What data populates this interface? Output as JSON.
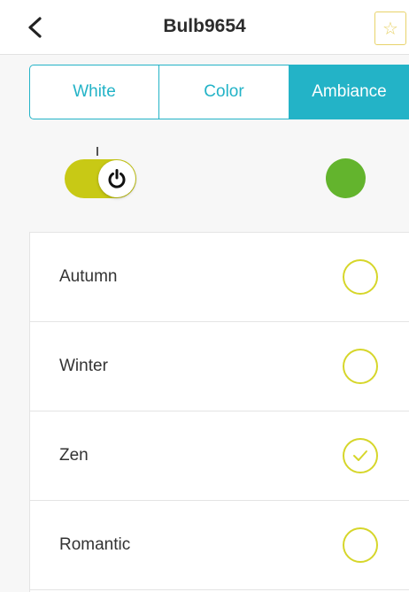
{
  "header": {
    "title": "Bulb9654",
    "back_icon": "chevron-left-icon",
    "favorite_icon": "star-outline-icon"
  },
  "tabs": [
    {
      "label": "White",
      "selected": false
    },
    {
      "label": "Color",
      "selected": false
    },
    {
      "label": "Ambiance",
      "selected": true
    }
  ],
  "power": {
    "on": true,
    "icon": "power-icon"
  },
  "current_color": "#63b42d",
  "colors": {
    "accent": "#23b3c7",
    "toggle": "#c8c915",
    "radio": "#d6d62a"
  },
  "scenes": [
    {
      "label": "Autumn",
      "selected": false
    },
    {
      "label": "Winter",
      "selected": false
    },
    {
      "label": "Zen",
      "selected": true
    },
    {
      "label": "Romantic",
      "selected": false
    }
  ]
}
